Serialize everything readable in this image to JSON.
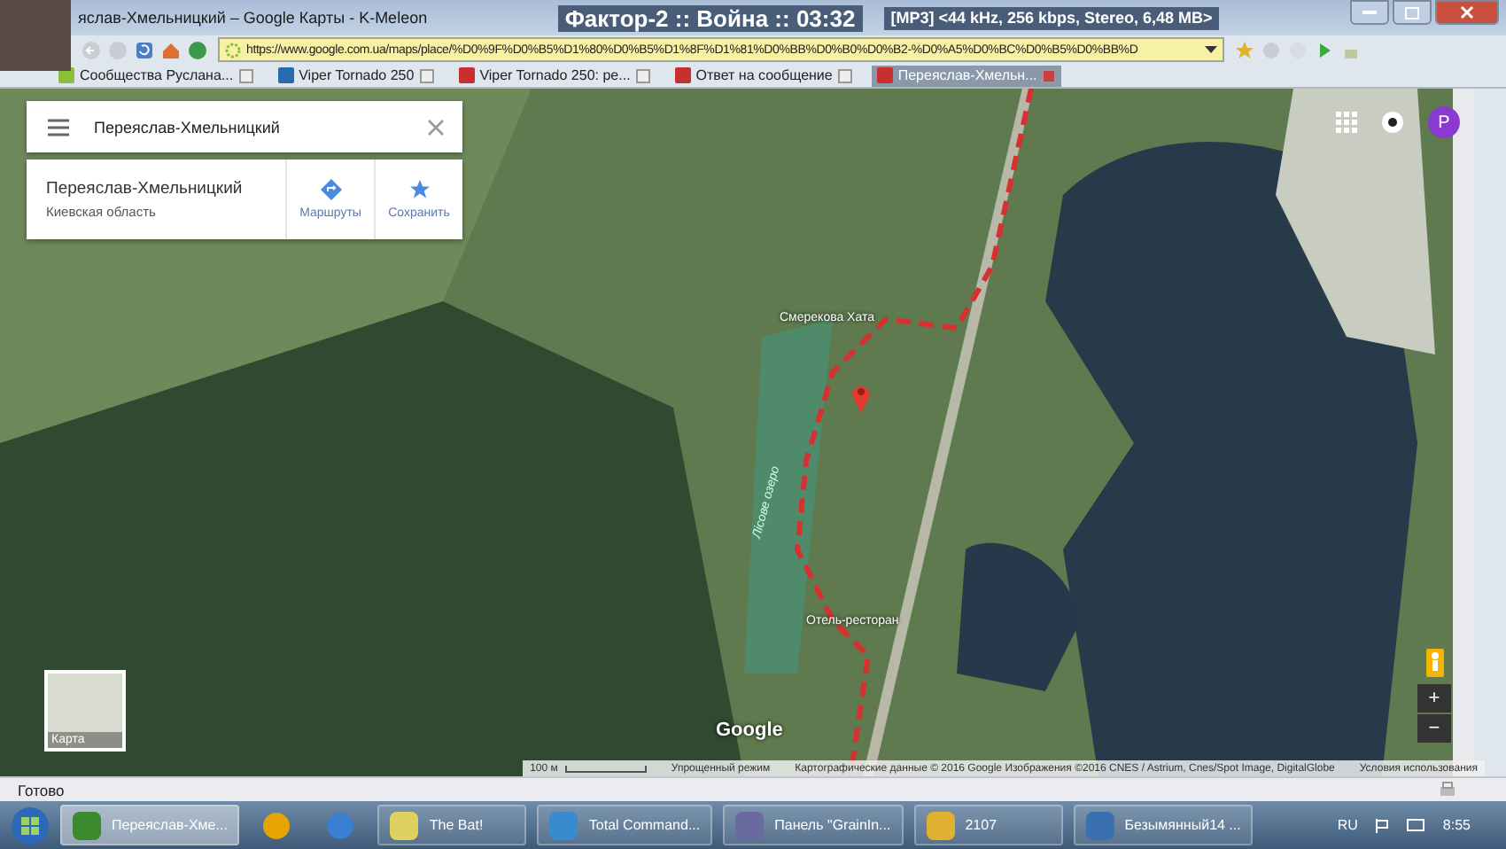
{
  "window": {
    "title": "яслав-Хмельницкий – Google Карты - K-Meleon"
  },
  "player_overlay": {
    "track": "Фактор-2 :: Война :: 03:32",
    "info": "[MP3] <44 kHz, 256 kbps, Stereo, 6,48 MB>"
  },
  "address_bar": {
    "url": "https://www.google.com.ua/maps/place/%D0%9F%D0%B5%D1%80%D0%B5%D1%8F%D1%81%D0%BB%D0%B0%D0%B2-%D0%A5%D0%BC%D0%B5%D0%BB%D"
  },
  "tabs": [
    {
      "label": "Сообщества Руслана...",
      "selected": false
    },
    {
      "label": "Viper Tornado 250",
      "selected": false
    },
    {
      "label": "Viper Tornado 250: ре...",
      "selected": false
    },
    {
      "label": "Ответ на сообщение",
      "selected": false
    },
    {
      "label": "Переяслав-Хмельн...",
      "selected": true
    }
  ],
  "map": {
    "search": {
      "value": "Переяслав-Хмельницкий"
    },
    "place": {
      "name": "Переяслав-Хмельницкий",
      "region": "Киевская область",
      "actions": [
        {
          "kind": "directions",
          "label": "Маршруты"
        },
        {
          "kind": "save",
          "label": "Сохранить"
        }
      ]
    },
    "account_initial": "P",
    "labels": [
      {
        "kind": "poi",
        "text": "Смерекова Хата"
      },
      {
        "kind": "water",
        "text": "Лісове озеро"
      },
      {
        "kind": "poi",
        "text": "Отель-ресторан"
      }
    ],
    "layer_toggle": "Карта",
    "logo": "Google",
    "zoom": {
      "in": "+",
      "out": "−"
    },
    "footer": {
      "scale": "100 м",
      "lite_mode": "Упрощенный режим",
      "attribution": "Картографические данные © 2016 Google Изображения ©2016 CNES / Astrium, Cnes/Spot Image, DigitalGlobe",
      "terms": "Условия использования"
    }
  },
  "status_bar": {
    "text": "Готово"
  },
  "taskbar": {
    "items": [
      {
        "kind": "window",
        "label": "Переяслав-Хме...",
        "selected": true
      },
      {
        "kind": "icon"
      },
      {
        "kind": "icon"
      },
      {
        "kind": "window",
        "label": "The Bat!",
        "selected": false
      },
      {
        "kind": "window",
        "label": "Total Command...",
        "selected": false
      },
      {
        "kind": "window",
        "label": "Панель \"GrainIn...",
        "selected": false
      },
      {
        "kind": "window",
        "label": "2107",
        "selected": false
      },
      {
        "kind": "window",
        "label": "Безымянный14 ...",
        "selected": false
      }
    ],
    "language": "RU",
    "time": "8:55"
  }
}
